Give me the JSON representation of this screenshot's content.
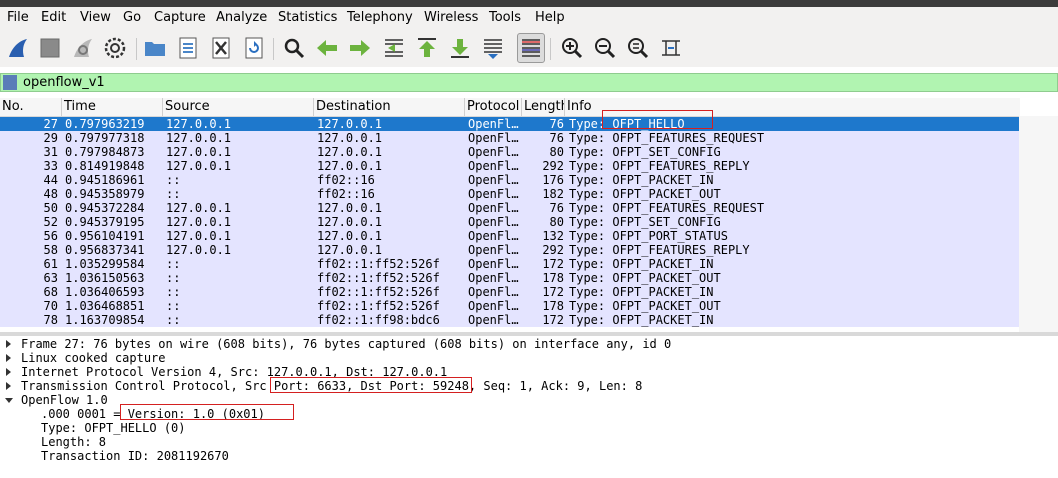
{
  "menu": [
    "File",
    "Edit",
    "View",
    "Go",
    "Capture",
    "Analyze",
    "Statistics",
    "Telephony",
    "Wireless",
    "Tools",
    "Help"
  ],
  "toolbar": {
    "icons": [
      "shark-fin-start-icon",
      "stop-square-icon",
      "restart-fin-icon",
      "capture-options-gear-icon",
      "open-folder-icon",
      "file-set-icon",
      "close-file-icon",
      "reload-icon",
      "find-magnifier-icon",
      "back-arrow-icon",
      "forward-arrow-icon",
      "go-to-packet-icon",
      "first-packet-icon",
      "last-packet-icon",
      "autoscroll-icon",
      "colorize-icon",
      "zoom-in-icon",
      "zoom-out-icon",
      "normal-size-icon",
      "resize-columns-icon"
    ]
  },
  "filter": {
    "value": "openflow_v1"
  },
  "packet_list": {
    "columns": [
      "No.",
      "Time",
      "Source",
      "Destination",
      "Protocol",
      "Length",
      "Info"
    ],
    "rows": [
      {
        "no": "27",
        "time": "0.797963219",
        "src": "127.0.0.1",
        "dst": "127.0.0.1",
        "proto": "OpenFl…",
        "len": "76",
        "info": "Type: OFPT_HELLO"
      },
      {
        "no": "29",
        "time": "0.797977318",
        "src": "127.0.0.1",
        "dst": "127.0.0.1",
        "proto": "OpenFl…",
        "len": "76",
        "info": "Type: OFPT_FEATURES_REQUEST"
      },
      {
        "no": "31",
        "time": "0.797984873",
        "src": "127.0.0.1",
        "dst": "127.0.0.1",
        "proto": "OpenFl…",
        "len": "80",
        "info": "Type: OFPT_SET_CONFIG"
      },
      {
        "no": "33",
        "time": "0.814919848",
        "src": "127.0.0.1",
        "dst": "127.0.0.1",
        "proto": "OpenFl…",
        "len": "292",
        "info": "Type: OFPT_FEATURES_REPLY"
      },
      {
        "no": "44",
        "time": "0.945186961",
        "src": "::",
        "dst": "ff02::16",
        "proto": "OpenFl…",
        "len": "176",
        "info": "Type: OFPT_PACKET_IN"
      },
      {
        "no": "48",
        "time": "0.945358979",
        "src": "::",
        "dst": "ff02::16",
        "proto": "OpenFl…",
        "len": "182",
        "info": "Type: OFPT_PACKET_OUT"
      },
      {
        "no": "50",
        "time": "0.945372284",
        "src": "127.0.0.1",
        "dst": "127.0.0.1",
        "proto": "OpenFl…",
        "len": "76",
        "info": "Type: OFPT_FEATURES_REQUEST"
      },
      {
        "no": "52",
        "time": "0.945379195",
        "src": "127.0.0.1",
        "dst": "127.0.0.1",
        "proto": "OpenFl…",
        "len": "80",
        "info": "Type: OFPT_SET_CONFIG"
      },
      {
        "no": "56",
        "time": "0.956104191",
        "src": "127.0.0.1",
        "dst": "127.0.0.1",
        "proto": "OpenFl…",
        "len": "132",
        "info": "Type: OFPT_PORT_STATUS"
      },
      {
        "no": "58",
        "time": "0.956837341",
        "src": "127.0.0.1",
        "dst": "127.0.0.1",
        "proto": "OpenFl…",
        "len": "292",
        "info": "Type: OFPT_FEATURES_REPLY"
      },
      {
        "no": "61",
        "time": "1.035299584",
        "src": "::",
        "dst": "ff02::1:ff52:526f",
        "proto": "OpenFl…",
        "len": "172",
        "info": "Type: OFPT_PACKET_IN"
      },
      {
        "no": "63",
        "time": "1.036150563",
        "src": "::",
        "dst": "ff02::1:ff52:526f",
        "proto": "OpenFl…",
        "len": "178",
        "info": "Type: OFPT_PACKET_OUT"
      },
      {
        "no": "68",
        "time": "1.036406593",
        "src": "::",
        "dst": "ff02::1:ff52:526f",
        "proto": "OpenFl…",
        "len": "172",
        "info": "Type: OFPT_PACKET_IN"
      },
      {
        "no": "70",
        "time": "1.036468851",
        "src": "::",
        "dst": "ff02::1:ff52:526f",
        "proto": "OpenFl…",
        "len": "178",
        "info": "Type: OFPT_PACKET_OUT"
      },
      {
        "no": "78",
        "time": "1.163709854",
        "src": "::",
        "dst": "ff02::1:ff98:bdc6",
        "proto": "OpenFl…",
        "len": "172",
        "info": "Type: OFPT_PACKET_IN"
      }
    ]
  },
  "details": [
    {
      "text": "Frame 27: 76 bytes on wire (608 bits), 76 bytes captured (608 bits) on interface any, id 0",
      "expander": "right",
      "indent": 0
    },
    {
      "text": "Linux cooked capture",
      "expander": "right",
      "indent": 0
    },
    {
      "text": "Internet Protocol Version 4, Src: 127.0.0.1, Dst: 127.0.0.1",
      "expander": "right",
      "indent": 0
    },
    {
      "text": "Transmission Control Protocol, Src Port: 6633, Dst Port: 59248, Seq: 1, Ack: 9, Len: 8",
      "expander": "right",
      "indent": 0
    },
    {
      "text": "OpenFlow 1.0",
      "expander": "down",
      "indent": 0
    },
    {
      "text": ".000 0001 = Version: 1.0 (0x01)",
      "expander": "none",
      "indent": 1
    },
    {
      "text": "Type: OFPT_HELLO (0)",
      "expander": "none",
      "indent": 1
    },
    {
      "text": "Length: 8",
      "expander": "none",
      "indent": 1
    },
    {
      "text": "Transaction ID: 2081192670",
      "expander": "none",
      "indent": 1
    }
  ],
  "colors": {
    "selected_row": "#1e78cc",
    "row_bg": "#e4e4ff",
    "filter_bg": "#b1f4b1",
    "highlight": "#d42020"
  }
}
